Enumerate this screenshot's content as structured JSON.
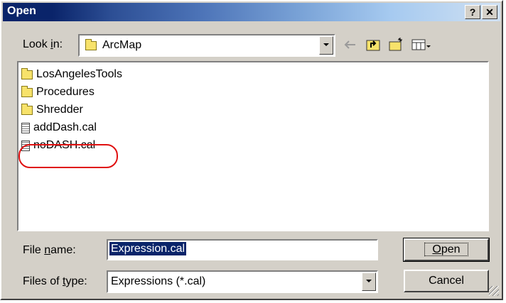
{
  "window": {
    "title": "Open",
    "help_label": "?",
    "close_label": "✕"
  },
  "look_in": {
    "label_pre": "Look ",
    "label_ul": "i",
    "label_post": "n:",
    "value": "ArcMap"
  },
  "toolbar": {
    "back_icon": "back-arrow-icon",
    "up_icon": "up-one-level-icon",
    "new_folder_icon": "new-folder-icon",
    "view_menu_icon": "view-menu-icon"
  },
  "files": [
    {
      "name": "LosAngelesTools",
      "type": "folder"
    },
    {
      "name": "Procedures",
      "type": "folder"
    },
    {
      "name": "Shredder",
      "type": "folder"
    },
    {
      "name": "addDash.cal",
      "type": "file"
    },
    {
      "name": "noDASH.cal",
      "type": "file",
      "highlighted": true
    }
  ],
  "file_name": {
    "label_pre": "File ",
    "label_ul": "n",
    "label_post": "ame:",
    "value": "Expression.cal"
  },
  "file_type": {
    "label_pre": "Files of ",
    "label_ul": "t",
    "label_post": "ype:",
    "value": "Expressions (*.cal)"
  },
  "buttons": {
    "open_ul": "O",
    "open_rest": "pen",
    "cancel": "Cancel"
  },
  "colors": {
    "title_start": "#0a246a",
    "title_end": "#cfe0f2",
    "highlight_circle": "#e01010",
    "face": "#d4d0c8"
  }
}
